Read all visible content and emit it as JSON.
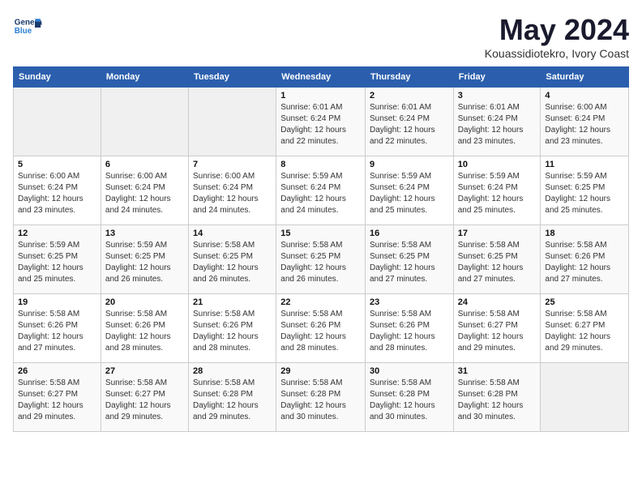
{
  "header": {
    "logo_line1": "General",
    "logo_line2": "Blue",
    "month": "May 2024",
    "location": "Kouassidiotekro, Ivory Coast"
  },
  "days_of_week": [
    "Sunday",
    "Monday",
    "Tuesday",
    "Wednesday",
    "Thursday",
    "Friday",
    "Saturday"
  ],
  "weeks": [
    [
      {
        "day": "",
        "info": ""
      },
      {
        "day": "",
        "info": ""
      },
      {
        "day": "",
        "info": ""
      },
      {
        "day": "1",
        "info": "Sunrise: 6:01 AM\nSunset: 6:24 PM\nDaylight: 12 hours\nand 22 minutes."
      },
      {
        "day": "2",
        "info": "Sunrise: 6:01 AM\nSunset: 6:24 PM\nDaylight: 12 hours\nand 22 minutes."
      },
      {
        "day": "3",
        "info": "Sunrise: 6:01 AM\nSunset: 6:24 PM\nDaylight: 12 hours\nand 23 minutes."
      },
      {
        "day": "4",
        "info": "Sunrise: 6:00 AM\nSunset: 6:24 PM\nDaylight: 12 hours\nand 23 minutes."
      }
    ],
    [
      {
        "day": "5",
        "info": "Sunrise: 6:00 AM\nSunset: 6:24 PM\nDaylight: 12 hours\nand 23 minutes."
      },
      {
        "day": "6",
        "info": "Sunrise: 6:00 AM\nSunset: 6:24 PM\nDaylight: 12 hours\nand 24 minutes."
      },
      {
        "day": "7",
        "info": "Sunrise: 6:00 AM\nSunset: 6:24 PM\nDaylight: 12 hours\nand 24 minutes."
      },
      {
        "day": "8",
        "info": "Sunrise: 5:59 AM\nSunset: 6:24 PM\nDaylight: 12 hours\nand 24 minutes."
      },
      {
        "day": "9",
        "info": "Sunrise: 5:59 AM\nSunset: 6:24 PM\nDaylight: 12 hours\nand 25 minutes."
      },
      {
        "day": "10",
        "info": "Sunrise: 5:59 AM\nSunset: 6:24 PM\nDaylight: 12 hours\nand 25 minutes."
      },
      {
        "day": "11",
        "info": "Sunrise: 5:59 AM\nSunset: 6:25 PM\nDaylight: 12 hours\nand 25 minutes."
      }
    ],
    [
      {
        "day": "12",
        "info": "Sunrise: 5:59 AM\nSunset: 6:25 PM\nDaylight: 12 hours\nand 25 minutes."
      },
      {
        "day": "13",
        "info": "Sunrise: 5:59 AM\nSunset: 6:25 PM\nDaylight: 12 hours\nand 26 minutes."
      },
      {
        "day": "14",
        "info": "Sunrise: 5:58 AM\nSunset: 6:25 PM\nDaylight: 12 hours\nand 26 minutes."
      },
      {
        "day": "15",
        "info": "Sunrise: 5:58 AM\nSunset: 6:25 PM\nDaylight: 12 hours\nand 26 minutes."
      },
      {
        "day": "16",
        "info": "Sunrise: 5:58 AM\nSunset: 6:25 PM\nDaylight: 12 hours\nand 27 minutes."
      },
      {
        "day": "17",
        "info": "Sunrise: 5:58 AM\nSunset: 6:25 PM\nDaylight: 12 hours\nand 27 minutes."
      },
      {
        "day": "18",
        "info": "Sunrise: 5:58 AM\nSunset: 6:26 PM\nDaylight: 12 hours\nand 27 minutes."
      }
    ],
    [
      {
        "day": "19",
        "info": "Sunrise: 5:58 AM\nSunset: 6:26 PM\nDaylight: 12 hours\nand 27 minutes."
      },
      {
        "day": "20",
        "info": "Sunrise: 5:58 AM\nSunset: 6:26 PM\nDaylight: 12 hours\nand 28 minutes."
      },
      {
        "day": "21",
        "info": "Sunrise: 5:58 AM\nSunset: 6:26 PM\nDaylight: 12 hours\nand 28 minutes."
      },
      {
        "day": "22",
        "info": "Sunrise: 5:58 AM\nSunset: 6:26 PM\nDaylight: 12 hours\nand 28 minutes."
      },
      {
        "day": "23",
        "info": "Sunrise: 5:58 AM\nSunset: 6:26 PM\nDaylight: 12 hours\nand 28 minutes."
      },
      {
        "day": "24",
        "info": "Sunrise: 5:58 AM\nSunset: 6:27 PM\nDaylight: 12 hours\nand 29 minutes."
      },
      {
        "day": "25",
        "info": "Sunrise: 5:58 AM\nSunset: 6:27 PM\nDaylight: 12 hours\nand 29 minutes."
      }
    ],
    [
      {
        "day": "26",
        "info": "Sunrise: 5:58 AM\nSunset: 6:27 PM\nDaylight: 12 hours\nand 29 minutes."
      },
      {
        "day": "27",
        "info": "Sunrise: 5:58 AM\nSunset: 6:27 PM\nDaylight: 12 hours\nand 29 minutes."
      },
      {
        "day": "28",
        "info": "Sunrise: 5:58 AM\nSunset: 6:28 PM\nDaylight: 12 hours\nand 29 minutes."
      },
      {
        "day": "29",
        "info": "Sunrise: 5:58 AM\nSunset: 6:28 PM\nDaylight: 12 hours\nand 30 minutes."
      },
      {
        "day": "30",
        "info": "Sunrise: 5:58 AM\nSunset: 6:28 PM\nDaylight: 12 hours\nand 30 minutes."
      },
      {
        "day": "31",
        "info": "Sunrise: 5:58 AM\nSunset: 6:28 PM\nDaylight: 12 hours\nand 30 minutes."
      },
      {
        "day": "",
        "info": ""
      }
    ]
  ]
}
